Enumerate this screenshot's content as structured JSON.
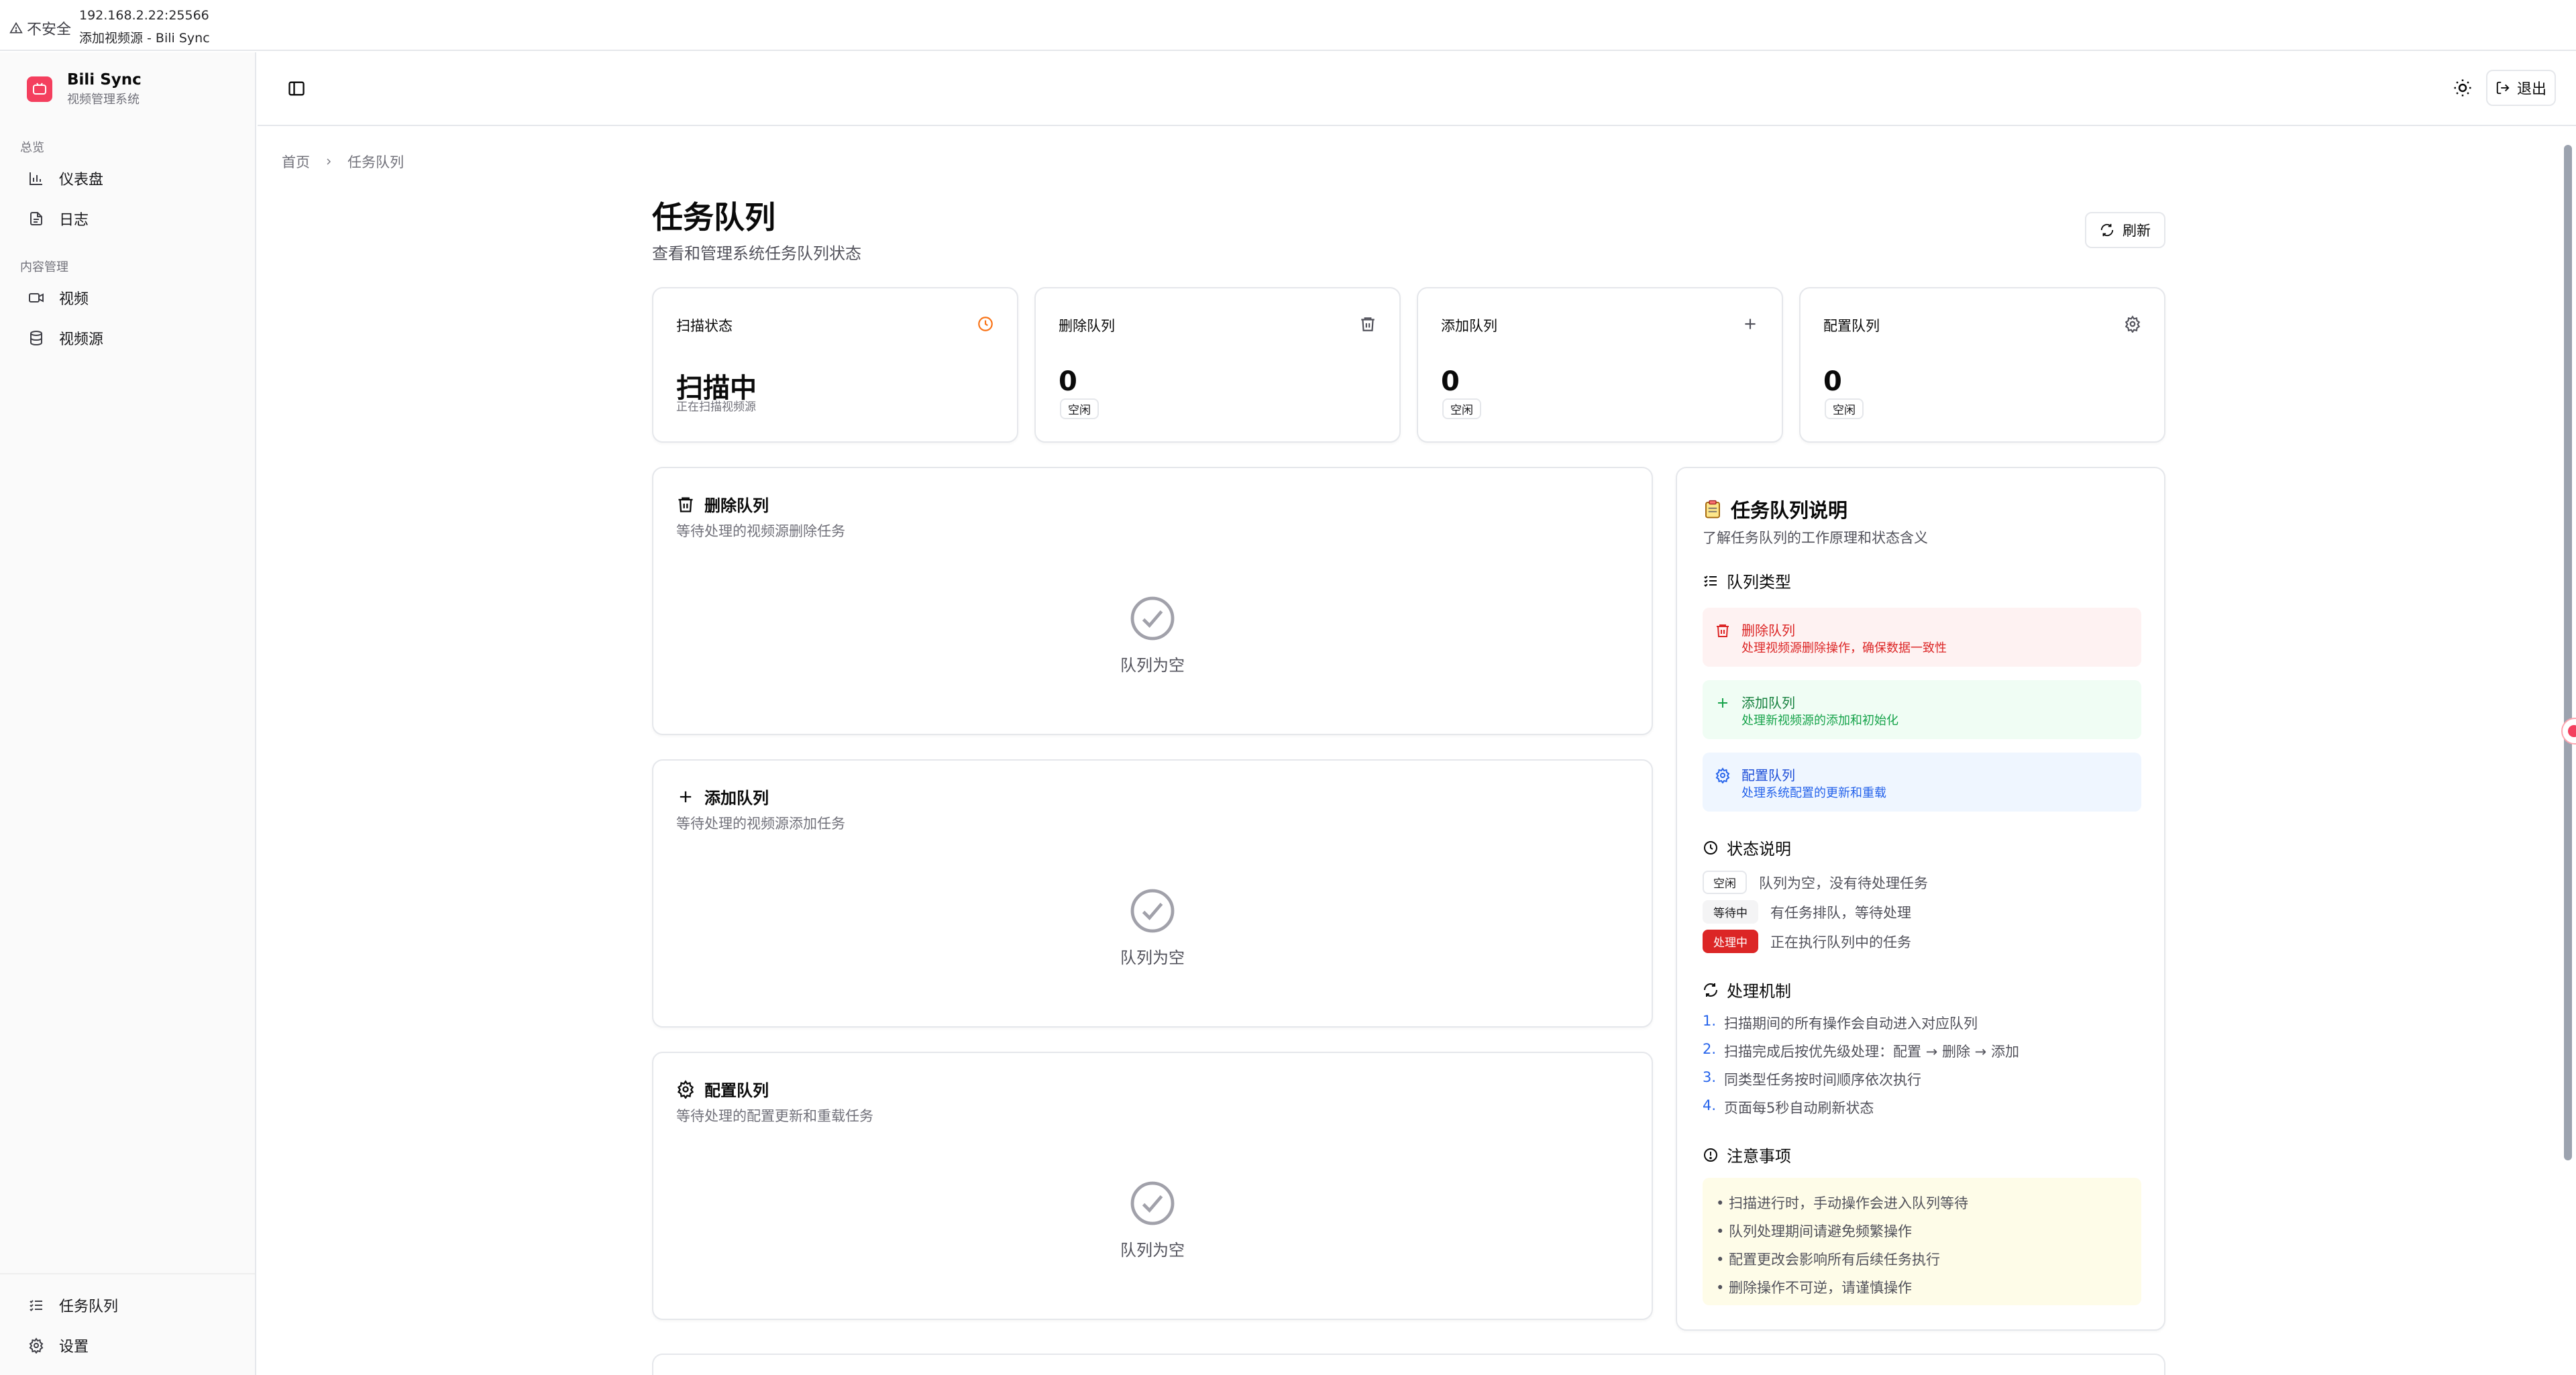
{
  "browser": {
    "insecure_label": "不安全",
    "url": "192.168.2.22:25566",
    "tab_title": "添加视频源 - Bili Sync"
  },
  "brand": {
    "name": "Bili Sync",
    "subtitle": "视频管理系统"
  },
  "sidebar": {
    "groups": [
      {
        "label": "总览",
        "items": [
          {
            "label": "仪表盘",
            "icon": "chart-icon"
          },
          {
            "label": "日志",
            "icon": "file-icon"
          }
        ]
      },
      {
        "label": "内容管理",
        "items": [
          {
            "label": "视频",
            "icon": "video-icon"
          },
          {
            "label": "视频源",
            "icon": "database-icon"
          }
        ]
      }
    ],
    "bottom_items": [
      {
        "label": "任务队列",
        "icon": "list-icon"
      },
      {
        "label": "设置",
        "icon": "gear-icon"
      }
    ]
  },
  "topbar": {
    "logout_label": "退出"
  },
  "breadcrumb": {
    "home": "首页",
    "current": "任务队列"
  },
  "header": {
    "title": "任务队列",
    "subtitle": "查看和管理系统任务队列状态",
    "refresh_label": "刷新"
  },
  "stats": [
    {
      "label": "扫描状态",
      "value": "扫描中",
      "desc": "正在扫描视频源",
      "icon": "clock-icon",
      "icon_color": "#f97316"
    },
    {
      "label": "删除队列",
      "value": "0",
      "badge": "空闲",
      "icon": "trash-icon"
    },
    {
      "label": "添加队列",
      "value": "0",
      "badge": "空闲",
      "icon": "plus-icon"
    },
    {
      "label": "配置队列",
      "value": "0",
      "badge": "空闲",
      "icon": "gear-icon"
    }
  ],
  "queues": [
    {
      "title": "删除队列",
      "subtitle": "等待处理的视频源删除任务",
      "empty": "队列为空"
    },
    {
      "title": "添加队列",
      "subtitle": "等待处理的视频源添加任务",
      "empty": "队列为空"
    },
    {
      "title": "配置队列",
      "subtitle": "等待处理的配置更新和重载任务",
      "empty": "队列为空"
    }
  ],
  "info": {
    "title": "任务队列说明",
    "subtitle": "了解任务队列的工作原理和状态含义",
    "types_heading": "队列类型",
    "types": [
      {
        "name": "删除队列",
        "desc": "处理视频源删除操作，确保数据一致性",
        "bg": "#fef2f2",
        "color": "#dc2626"
      },
      {
        "name": "添加队列",
        "desc": "处理新视频源的添加和初始化",
        "bg": "#f0fdf4",
        "color": "#16a34a"
      },
      {
        "name": "配置队列",
        "desc": "处理系统配置的更新和重载",
        "bg": "#eff6ff",
        "color": "#2563eb"
      }
    ],
    "status_heading": "状态说明",
    "statuses": [
      {
        "badge": "空闲",
        "desc": "队列为空，没有待处理任务"
      },
      {
        "badge": "等待中",
        "desc": "有任务排队，等待处理"
      },
      {
        "badge": "处理中",
        "desc": "正在执行队列中的任务"
      }
    ],
    "mechanism_heading": "处理机制",
    "mechanism": [
      {
        "num": "1.",
        "text": "扫描期间的所有操作会自动进入对应队列"
      },
      {
        "num": "2.",
        "text": "扫描完成后按优先级处理：配置 → 删除 → 添加"
      },
      {
        "num": "3.",
        "text": "同类型任务按时间顺序依次执行"
      },
      {
        "num": "4.",
        "text": "页面每5秒自动刷新状态"
      }
    ],
    "notes_heading": "注意事项",
    "notes": [
      "• 扫描进行时，手动操作会进入队列等待",
      "• 队列处理期间请避免频繁操作",
      "• 配置更改会影响所有后续任务执行",
      "• 删除操作不可逆，请谨慎操作"
    ]
  }
}
